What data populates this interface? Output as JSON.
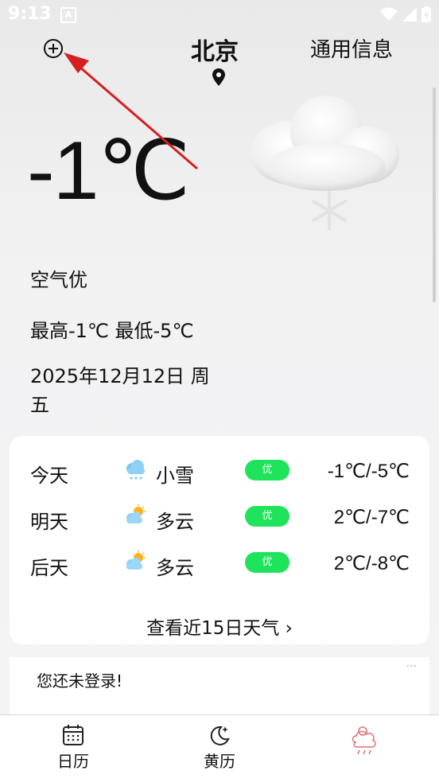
{
  "status_bar": {
    "time": "9:13",
    "notif_letter": "A"
  },
  "header": {
    "city": "北京",
    "general_info": "通用信息"
  },
  "current": {
    "temperature": "-1℃",
    "air_quality": "空气优",
    "high_low": "最高-1℃ 最低-5℃",
    "date": "2025年12月12日 周五"
  },
  "forecast": {
    "rows": [
      {
        "day": "今天",
        "icon": "light-snow-icon",
        "condition": "小雪",
        "aq": "优",
        "range": "-1℃/-5℃"
      },
      {
        "day": "明天",
        "icon": "partly-cloudy-icon",
        "condition": "多云",
        "aq": "优",
        "range": "2℃/-7℃"
      },
      {
        "day": "后天",
        "icon": "partly-cloudy-icon",
        "condition": "多云",
        "aq": "优",
        "range": "2℃/-8℃"
      }
    ],
    "more": "查看近15日天气 ›"
  },
  "login": {
    "text": "您还未登录!",
    "more": "···"
  },
  "tabbar": {
    "tabs": [
      {
        "label": "日历"
      },
      {
        "label": "黄历"
      },
      {
        "label": ""
      }
    ]
  },
  "colors": {
    "aq_badge": "#1fe35a",
    "annotation_arrow": "#d42020",
    "weather_tab_icon": "#e07070"
  }
}
